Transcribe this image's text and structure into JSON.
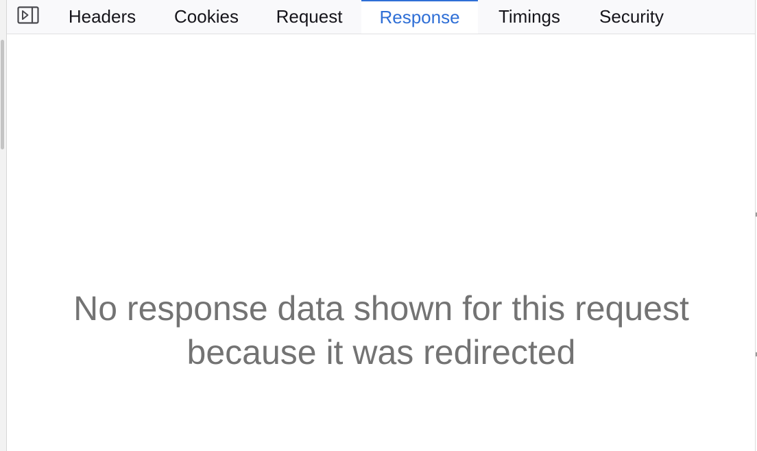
{
  "toolbar": {
    "toggle_icon": "sidebar-toggle-icon"
  },
  "tabs": [
    {
      "label": "Headers",
      "active": false
    },
    {
      "label": "Cookies",
      "active": false
    },
    {
      "label": "Request",
      "active": false
    },
    {
      "label": "Response",
      "active": true
    },
    {
      "label": "Timings",
      "active": false
    },
    {
      "label": "Security",
      "active": false
    }
  ],
  "response_panel": {
    "message_line1": "No response data shown for this request",
    "message_line2": "because it was redirected"
  },
  "colors": {
    "active_tab": "#2f6fd6",
    "message_text": "#737373",
    "tab_text": "#15141a"
  }
}
